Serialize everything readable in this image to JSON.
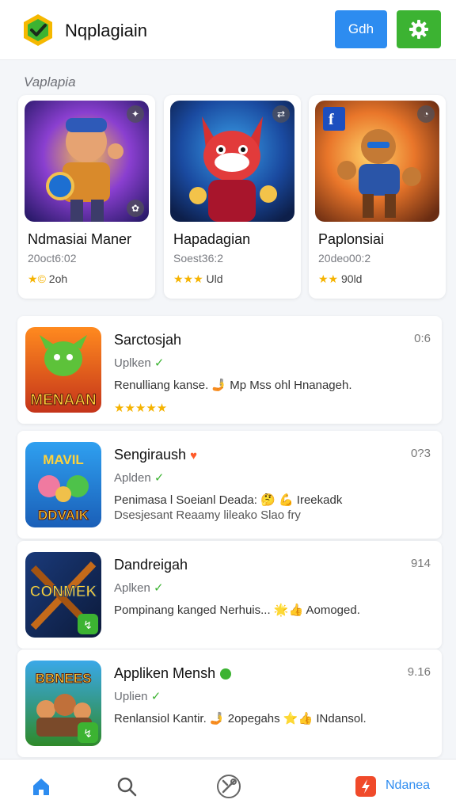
{
  "header": {
    "title": "Nqplagiain",
    "primary_button": "Gdh",
    "logo_icon": "shield-check-icon",
    "settings_icon": "gear-icon"
  },
  "section": {
    "label": "Vaplapia"
  },
  "featured": [
    {
      "name": "Ndmasiai Maner",
      "date": "20oct6:02",
      "rating_text": "2oh"
    },
    {
      "name": "Hapadagian",
      "date": "Soest36:2",
      "rating_text": "Uld"
    },
    {
      "name": "Paplonsiai",
      "date": "20deo00:2",
      "rating_text": "90ld"
    }
  ],
  "list": [
    {
      "title": "Sarctosjah",
      "sub": "Uplken",
      "desc": "Renulliang kanse. 🤳 Mp Mss ohl Hnanageh.",
      "desc2": "",
      "time": "0:6",
      "stars": "★★★★★",
      "art_text": "MENAAN"
    },
    {
      "title": "Sengiraush",
      "sub": "Aplden",
      "desc": "Penimasa l Soeianl Deada: 🤔 💪 Ireekadk",
      "desc2": "Dsesjesant Reaamy lileako Slao fry",
      "time": "0?3",
      "stars": "",
      "art_text": "DDVAIK"
    },
    {
      "title": "Dandreigah",
      "sub": "Aplken",
      "desc": "Pompinang kanged Nerhuis... 🌟👍 Aomoged.",
      "desc2": "",
      "time": "914",
      "stars": "",
      "art_text": "CONMEK"
    },
    {
      "title": "Appliken Mensh",
      "sub": "Uplien",
      "desc": "Renlansiol Kantir. 🤳 2opegahs ⭐👍 INdansol.",
      "desc2": "",
      "time": "9.16",
      "stars": "",
      "art_text": "BBNEES"
    }
  ],
  "nav": {
    "right_label": "Ndanea"
  },
  "colors": {
    "accent": "#2d8cf0",
    "green": "#3cb332",
    "star": "#f5b301"
  }
}
